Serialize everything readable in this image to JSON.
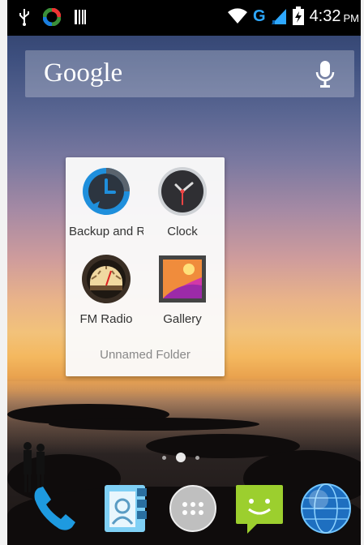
{
  "status_bar": {
    "time": "4:32",
    "ampm": "PM",
    "network_type": "G",
    "left_icons": [
      "usb-icon",
      "app-notification-icon",
      "storage-icon"
    ],
    "right_icons": [
      "wifi-icon",
      "signal-icon",
      "battery-icon"
    ]
  },
  "search": {
    "logo": "Google",
    "icon": "mic-icon"
  },
  "folder": {
    "name": "Unnamed Folder",
    "apps": [
      {
        "label": "Backup and Restore",
        "icon": "backup-icon"
      },
      {
        "label": "Clock",
        "icon": "clock-icon"
      },
      {
        "label": "FM Radio",
        "icon": "fm-radio-icon"
      },
      {
        "label": "Gallery",
        "icon": "gallery-icon"
      }
    ]
  },
  "pager": {
    "pages": 3,
    "current": 2
  },
  "dock": [
    {
      "name": "Phone",
      "icon": "phone-icon"
    },
    {
      "name": "Contacts",
      "icon": "contacts-icon"
    },
    {
      "name": "All apps",
      "icon": "app-drawer-icon"
    },
    {
      "name": "Messaging",
      "icon": "messaging-icon"
    },
    {
      "name": "Browser",
      "icon": "browser-icon"
    }
  ],
  "colors": {
    "accent": "#2ea8ff",
    "status_bar": "#000000",
    "folder_bg": "#fafafa"
  }
}
